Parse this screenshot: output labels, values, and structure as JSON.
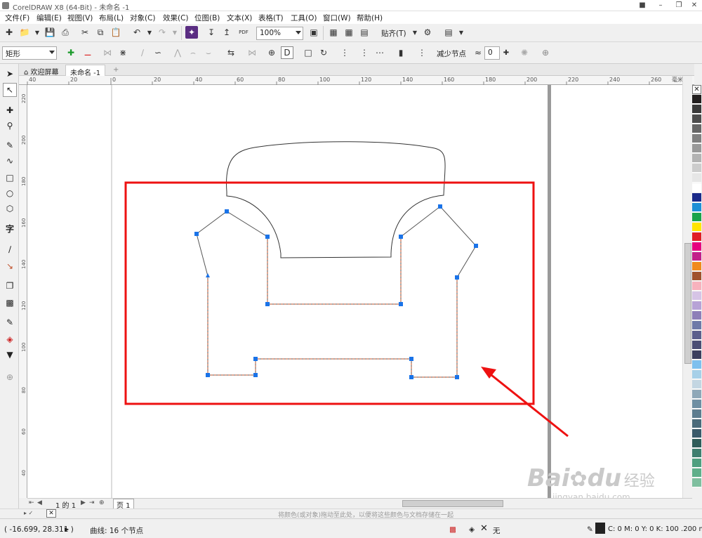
{
  "window": {
    "title": "CorelDRAW X8 (64-Bit) - 未命名 -1"
  },
  "menu": [
    "文件(F)",
    "编辑(E)",
    "视图(V)",
    "布局(L)",
    "对象(C)",
    "效果(C)",
    "位图(B)",
    "文本(X)",
    "表格(T)",
    "工具(O)",
    "窗口(W)",
    "帮助(H)"
  ],
  "toolbar": {
    "zoom": "100%",
    "snap_label": "贴齐(T)",
    "pdf_label": "PDF"
  },
  "propertybar": {
    "shape_type": "矩形",
    "reduce_nodes": "减少节点",
    "smooth_value": "0"
  },
  "tabs": {
    "home": "欢迎屏幕",
    "doc": "未命名 -1"
  },
  "ruler": {
    "h_ticks": [
      "40",
      "20",
      "0",
      "20",
      "40",
      "60",
      "80",
      "100",
      "120",
      "140",
      "160",
      "180",
      "200",
      "220",
      "240",
      "260"
    ],
    "h_unit": "毫米",
    "v_ticks": [
      "220",
      "200",
      "180",
      "160",
      "140",
      "120",
      "100",
      "80",
      "60",
      "40"
    ]
  },
  "pages": {
    "count_label": "1 的 1",
    "page_tab": "页 1"
  },
  "hint": "将颜色(或对象)拖动至此处，以便将这些颜色与文档存储在一起",
  "status": {
    "coords": "( -16.699, 28.311 )",
    "object_info": "曲线: 16 个节点",
    "fill_none": "无",
    "outline_info": "C: 0 M: 0 Y: 0 K: 100  .200 mm"
  },
  "watermark": {
    "brand": "Bai",
    "brand2": "du",
    "brand3": "经验",
    "url": "jingyan.baidu.com"
  },
  "colors": {
    "highlight_box": "#ee1111",
    "arrow": "#ee1111",
    "node": "#1a73e8",
    "dashed": "#c0502a",
    "accent": "#1a73e8"
  },
  "palette_colors": [
    "#221f1f",
    "#3a3a3a",
    "#4d4d4d",
    "#666666",
    "#808080",
    "#999999",
    "#b3b3b3",
    "#cccccc",
    "#e6e6e6",
    "#ffffff",
    "#1b2a8a",
    "#1e90d6",
    "#1aa34a",
    "#ffe400",
    "#e01f26",
    "#e6007e",
    "#c21f8a",
    "#f08a1c",
    "#a0522d",
    "#f7b2bd",
    "#d6c4e6",
    "#b7a3d6",
    "#8e7fb8",
    "#6e7aa8",
    "#5c5f8c",
    "#4b4e74",
    "#3c3f5e",
    "#7ec0ee",
    "#a7d0e8",
    "#c3d6e2",
    "#8fa8b8",
    "#6f8fa3",
    "#5e7d8f",
    "#4a6a7a",
    "#3a5a6a",
    "#2f5d5a",
    "#3f7f6f",
    "#4f9f7f",
    "#5faf8a",
    "#7fbf9f"
  ]
}
